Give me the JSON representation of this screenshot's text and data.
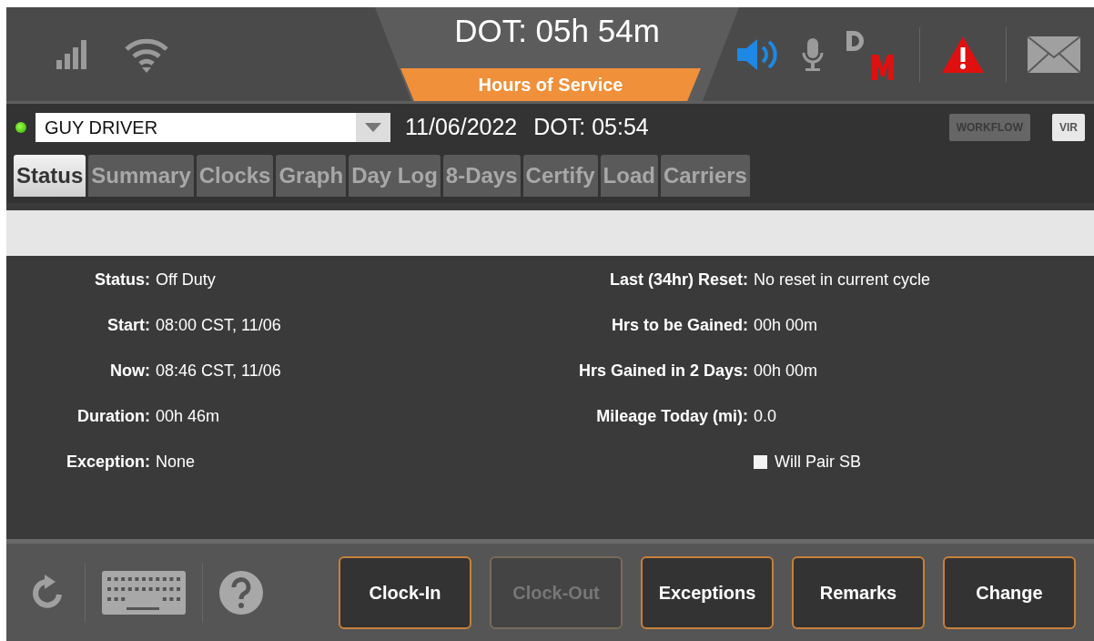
{
  "header": {
    "dot_clock": "DOT: 05h 54m",
    "title": "Hours of Service",
    "speaker_on": true,
    "alert": true
  },
  "driver_bar": {
    "online": true,
    "driver": "GUY DRIVER",
    "date": "11/06/2022",
    "dot": "DOT: 05:54",
    "buttons": [
      {
        "label": "WORKFLOW",
        "disabled": true
      },
      {
        "label": "VIR",
        "disabled": false
      }
    ]
  },
  "tabs": [
    {
      "label": "Status",
      "selected": true
    },
    {
      "label": "Summary",
      "selected": false
    },
    {
      "label": "Clocks",
      "selected": false
    },
    {
      "label": "Graph",
      "selected": false
    },
    {
      "label": "Day Log",
      "selected": false
    },
    {
      "label": "8-Days",
      "selected": false
    },
    {
      "label": "Certify",
      "selected": false
    },
    {
      "label": "Load",
      "selected": false
    },
    {
      "label": "Carriers",
      "selected": false
    }
  ],
  "details_left": [
    {
      "label": "Status:",
      "value": "Off Duty"
    },
    {
      "label": "Start:",
      "value": "08:00 CST, 11/06"
    },
    {
      "label": "Now:",
      "value": "08:46 CST, 11/06"
    },
    {
      "label": "Duration:",
      "value": "00h 46m"
    },
    {
      "label": "Exception:",
      "value": "None"
    }
  ],
  "details_right": [
    {
      "label": "Last (34hr) Reset:",
      "value": "No reset in current cycle"
    },
    {
      "label": "Hrs to be Gained:",
      "value": "00h 00m"
    },
    {
      "label": "Hrs Gained in 2 Days:",
      "value": "00h 00m"
    },
    {
      "label": "Mileage Today (mi):",
      "value": "0.0"
    }
  ],
  "will_pair": {
    "label": "Will Pair SB",
    "checked": false
  },
  "actions": [
    {
      "label": "Clock-In",
      "disabled": false
    },
    {
      "label": "Clock-Out",
      "disabled": true
    },
    {
      "label": "Exceptions",
      "disabled": false
    },
    {
      "label": "Remarks",
      "disabled": false
    },
    {
      "label": "Change",
      "disabled": false
    }
  ]
}
